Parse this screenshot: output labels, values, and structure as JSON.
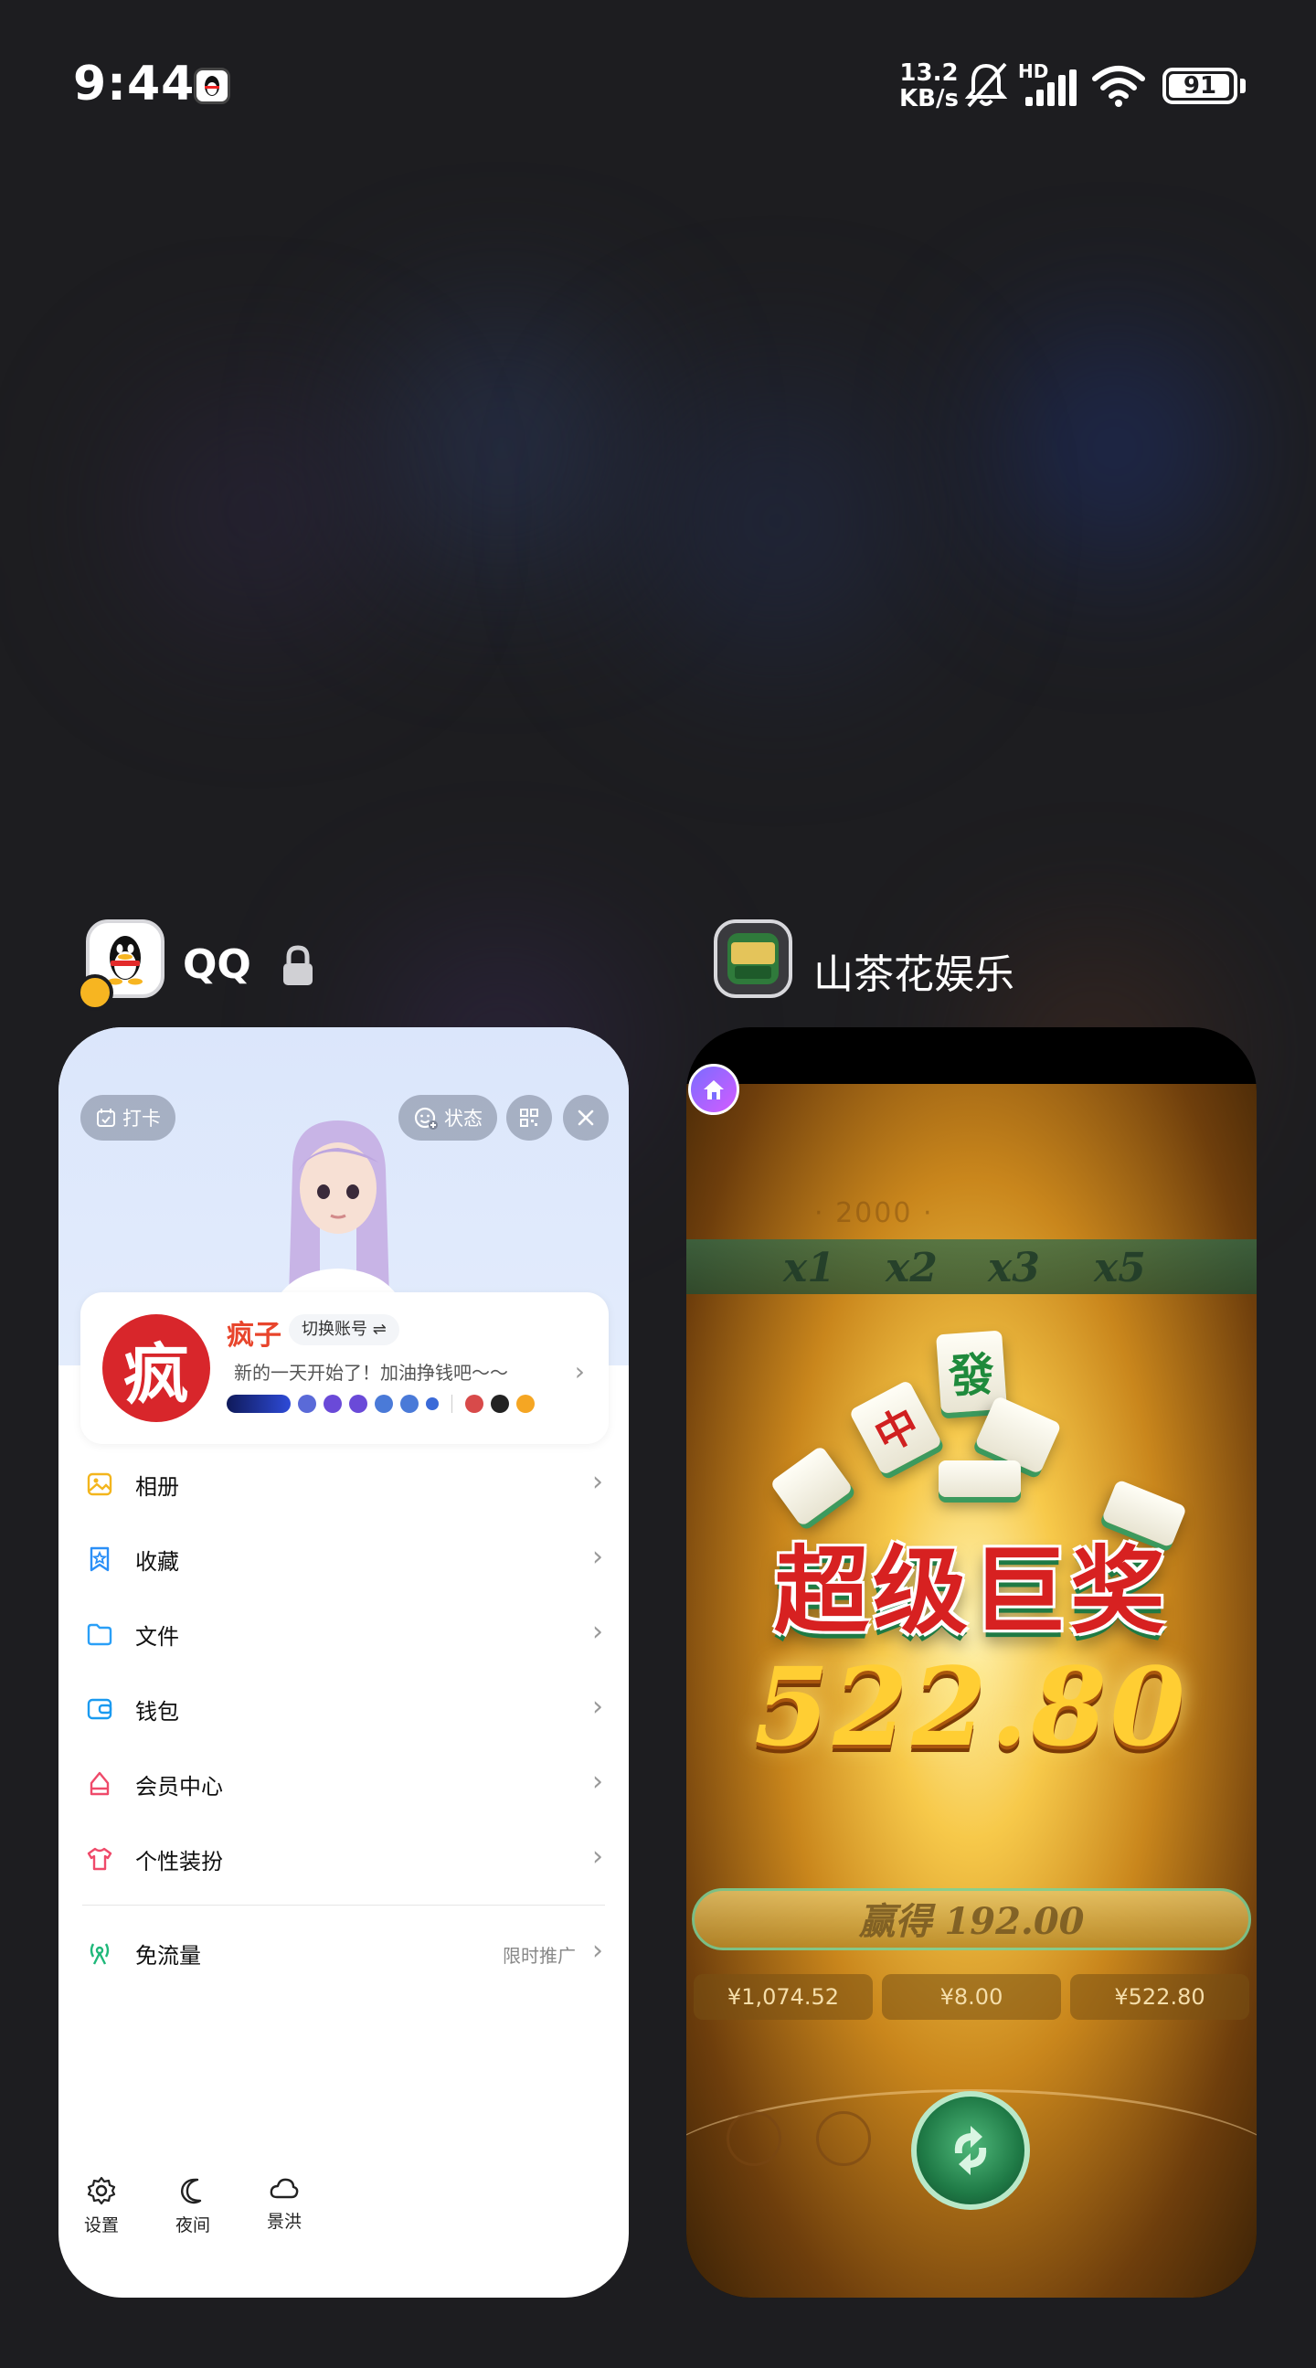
{
  "status_bar": {
    "time": "9:44",
    "net_speed_value": "13.2",
    "net_speed_unit": "KB/s",
    "signal_label": "HD",
    "battery": "91"
  },
  "apps": [
    {
      "name": "QQ",
      "icon": "qq-penguin-icon",
      "locked": true,
      "card": {
        "checkin_label": "打卡",
        "status_label": "状态",
        "profile": {
          "name": "疯子",
          "avatar_char": "疯",
          "switch_account": "切换账号 ⇌",
          "signature": "新的一天开始了！加油挣钱吧～～"
        },
        "menu": [
          {
            "label": "相册",
            "icon": "photo-album-icon"
          },
          {
            "label": "收藏",
            "icon": "favorites-icon"
          },
          {
            "label": "文件",
            "icon": "folder-icon"
          },
          {
            "label": "钱包",
            "icon": "wallet-icon"
          },
          {
            "label": "会员中心",
            "icon": "vip-center-icon"
          },
          {
            "label": "个性装扮",
            "icon": "tshirt-icon"
          }
        ],
        "free_data": {
          "label": "免流量",
          "extra": "限时推广",
          "icon": "signal-tower-icon"
        },
        "bottom_bar": [
          {
            "label": "设置",
            "icon": "gear-icon"
          },
          {
            "label": "夜间",
            "icon": "moon-icon"
          },
          {
            "label": "景洪",
            "icon": "cloud-icon"
          }
        ]
      }
    },
    {
      "name": "山茶花娱乐",
      "icon": "game-app-icon",
      "card": {
        "multipliers": [
          "x1",
          "x2",
          "x3",
          "x5"
        ],
        "headline": "超级巨奖",
        "amount": "522.80",
        "win_text": "赢得 192.00",
        "stats": [
          "¥1,074.52",
          "¥8.00",
          "¥522.80"
        ],
        "tiles": [
          "發",
          "中"
        ]
      }
    }
  ],
  "colors": {
    "background": "#1d1d20",
    "qq_header": "#dbe6fb",
    "profile_name": "#e8452c",
    "avatar_red": "#d8262b",
    "game_gold": "#ffce33",
    "game_red": "#d72121"
  }
}
